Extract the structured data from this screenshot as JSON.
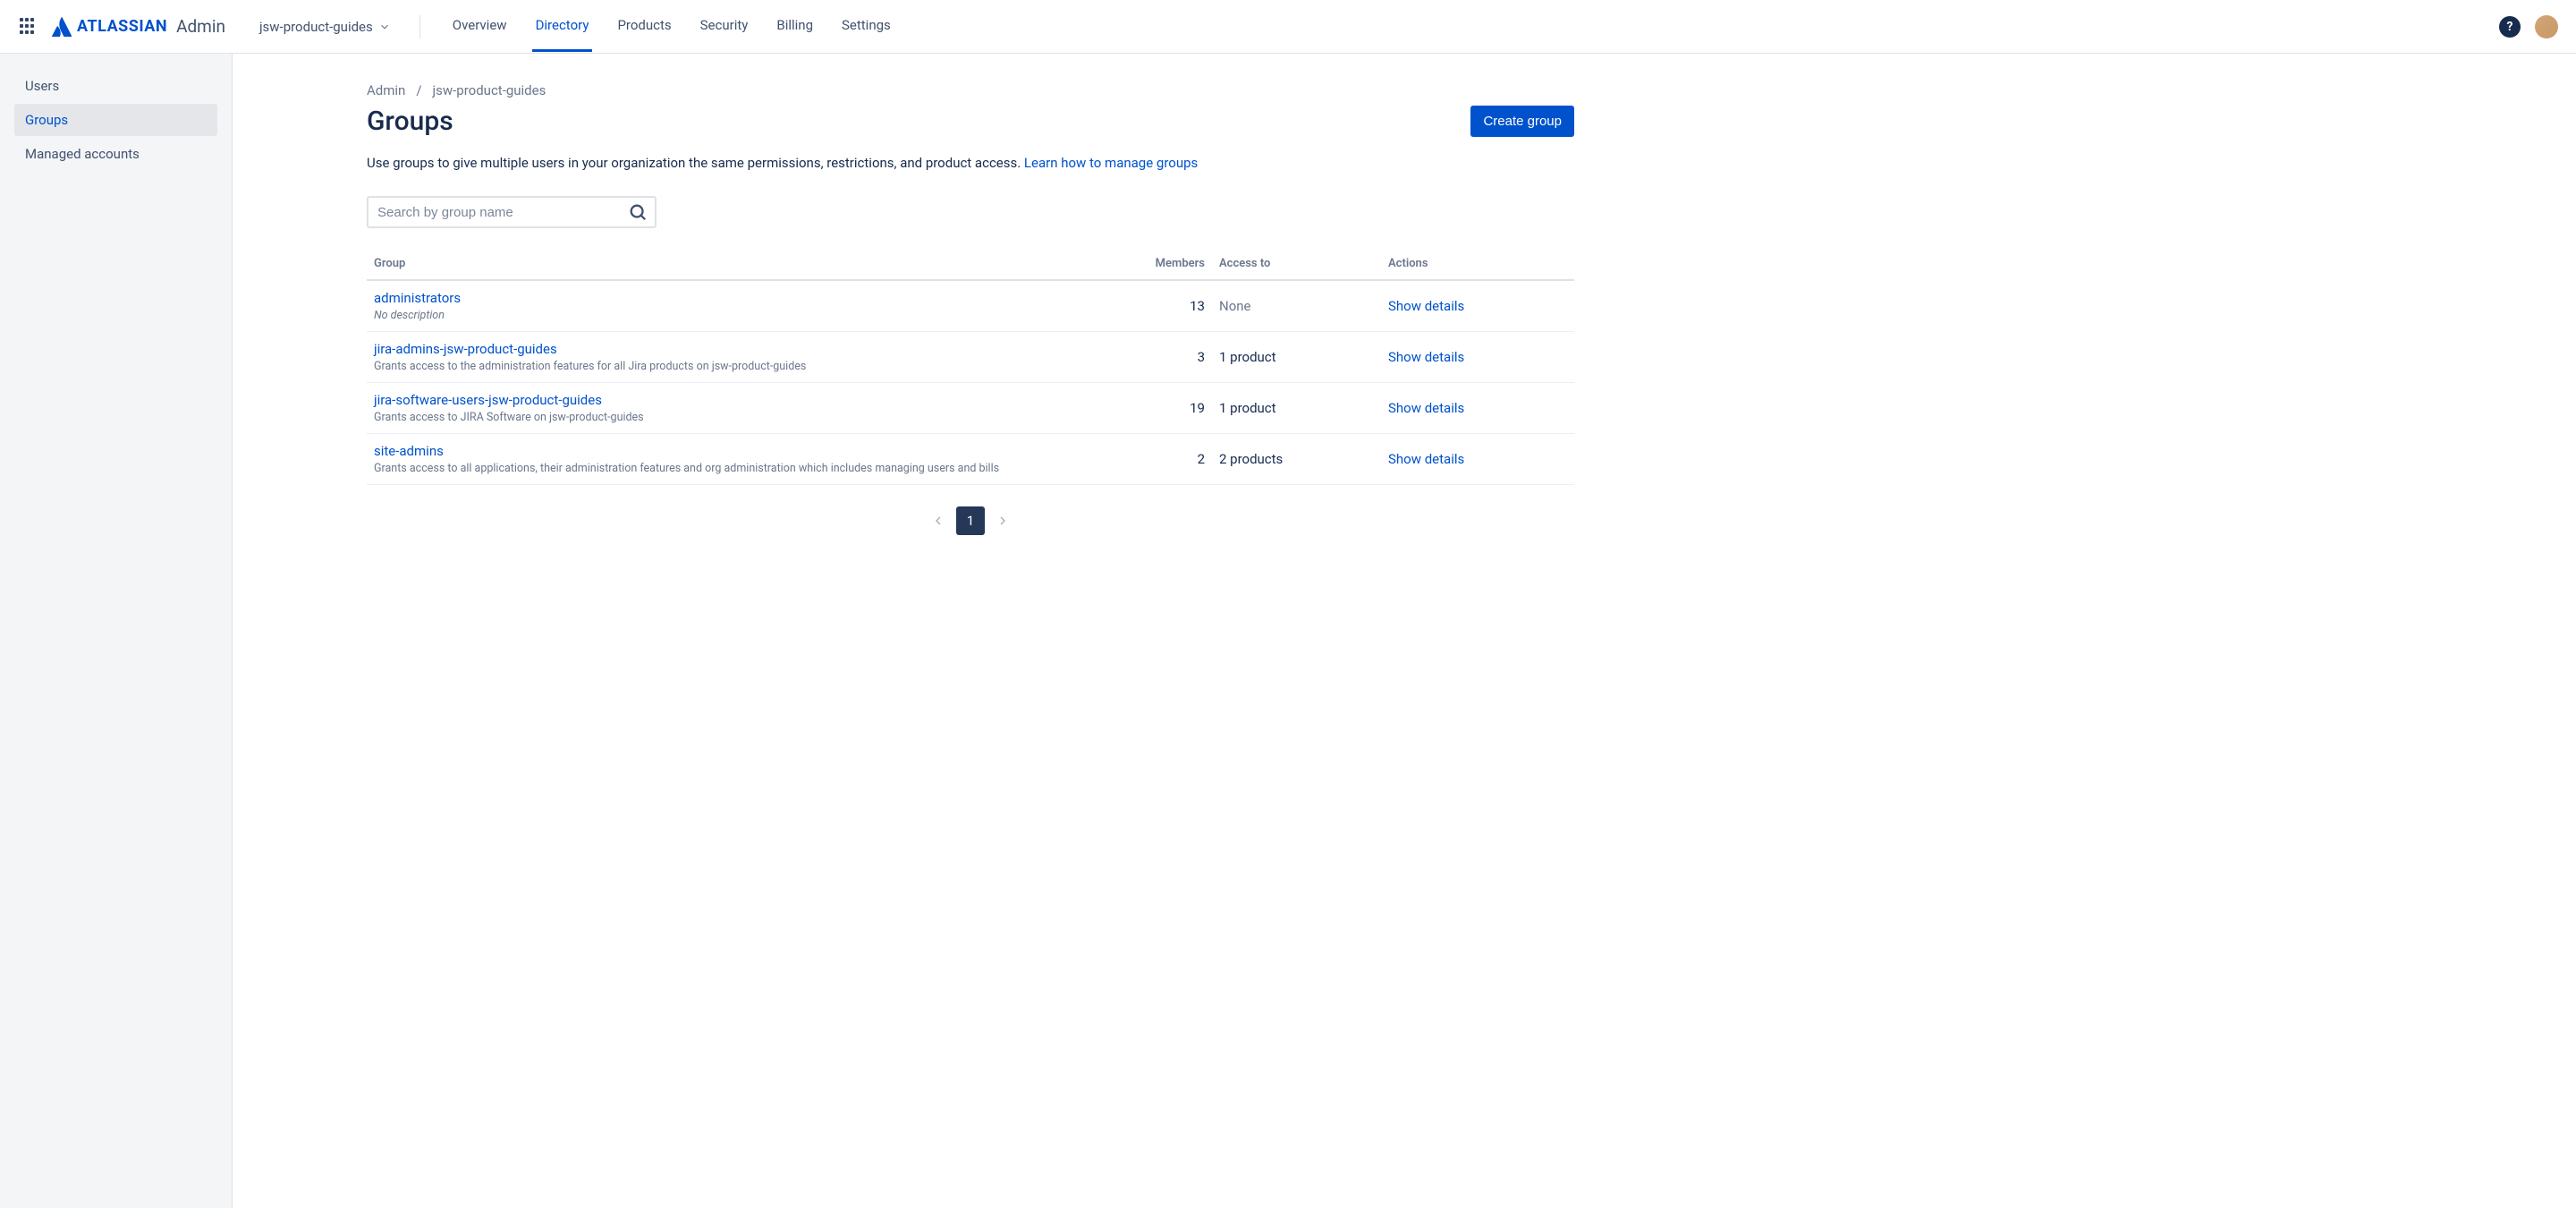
{
  "header": {
    "logo_text": "ATLASSIAN",
    "admin_text": "Admin",
    "org_name": "jsw-product-guides",
    "nav": [
      {
        "label": "Overview",
        "active": false
      },
      {
        "label": "Directory",
        "active": true
      },
      {
        "label": "Products",
        "active": false
      },
      {
        "label": "Security",
        "active": false
      },
      {
        "label": "Billing",
        "active": false
      },
      {
        "label": "Settings",
        "active": false
      }
    ]
  },
  "sidebar": {
    "items": [
      {
        "label": "Users",
        "active": false
      },
      {
        "label": "Groups",
        "active": true
      },
      {
        "label": "Managed accounts",
        "active": false
      }
    ]
  },
  "breadcrumb": {
    "0": "Admin",
    "1": "jsw-product-guides"
  },
  "page": {
    "title": "Groups",
    "create_btn": "Create group",
    "desc_text": "Use groups to give multiple users in your organization the same permissions, restrictions, and product access. ",
    "learn_link": "Learn how to manage groups"
  },
  "search": {
    "placeholder": "Search by group name"
  },
  "table": {
    "headers": {
      "group": "Group",
      "members": "Members",
      "access": "Access to",
      "actions": "Actions"
    },
    "rows": [
      {
        "name": "administrators",
        "desc": "No description",
        "desc_italic": true,
        "members": "13",
        "access": "None",
        "access_muted": true,
        "action": "Show details"
      },
      {
        "name": "jira-admins-jsw-product-guides",
        "desc": "Grants access to the administration features for all Jira products on jsw-product-guides",
        "desc_italic": false,
        "members": "3",
        "access": "1 product",
        "access_muted": false,
        "action": "Show details"
      },
      {
        "name": "jira-software-users-jsw-product-guides",
        "desc": "Grants access to JIRA Software on jsw-product-guides",
        "desc_italic": false,
        "members": "19",
        "access": "1 product",
        "access_muted": false,
        "action": "Show details"
      },
      {
        "name": "site-admins",
        "desc": "Grants access to all applications, their administration features and org administration which includes managing users and bills",
        "desc_italic": false,
        "members": "2",
        "access": "2 products",
        "access_muted": false,
        "action": "Show details"
      }
    ]
  },
  "pagination": {
    "current": "1"
  }
}
